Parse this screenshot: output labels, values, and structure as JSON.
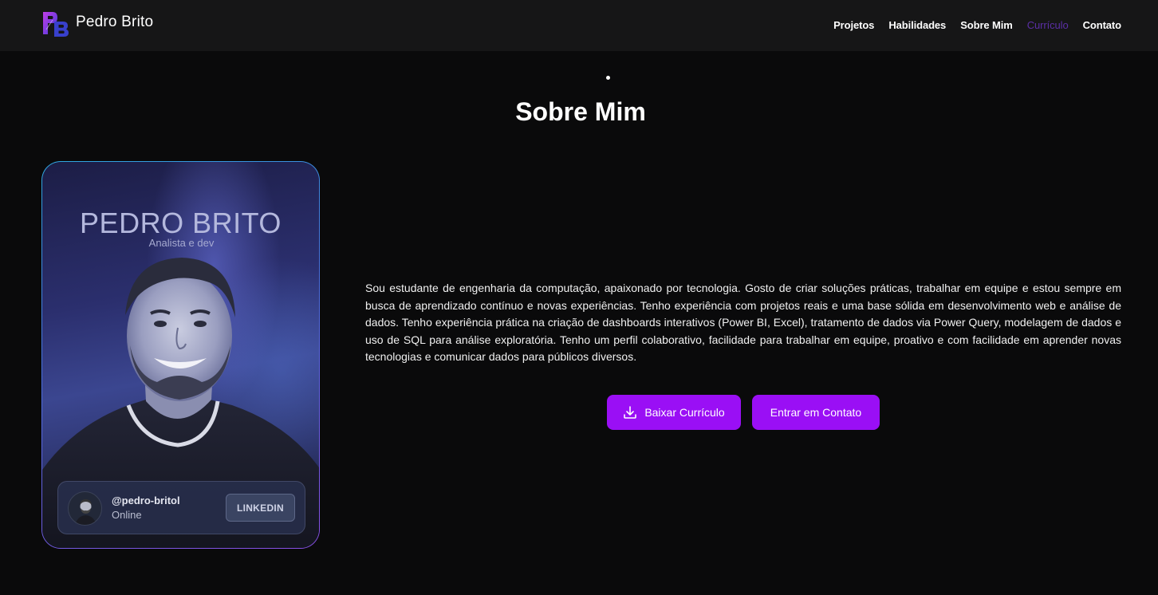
{
  "brand": {
    "logo_letters": "PB",
    "name": "Pedro Brito"
  },
  "nav": {
    "items": [
      {
        "label": "Projetos"
      },
      {
        "label": "Habilidades"
      },
      {
        "label": "Sobre Mim"
      },
      {
        "label": "Currículo",
        "active": true
      },
      {
        "label": "Contato"
      }
    ]
  },
  "about": {
    "title": "Sobre Mim",
    "bio": "Sou estudante de engenharia da computação, apaixonado por tecnologia. Gosto de criar soluções práticas, trabalhar em equipe e estou sempre em busca de aprendizado contínuo e novas experiências. Tenho experiência com projetos reais e uma base sólida em desenvolvimento web e análise de dados. Tenho experiência prática na criação de dashboards interativos (Power BI, Excel), tratamento de dados via Power Query, modelagem de dados e uso de SQL para análise exploratória. Tenho um perfil colaborativo, facilidade para trabalhar em equipe, proativo e com facilidade em aprender novas tecnologias e comunicar dados para públicos diversos."
  },
  "profile_card": {
    "name": "PEDRO BRITO",
    "subtitle": "Analista e dev",
    "handle": "@pedro-britol",
    "status": "Online",
    "button_label": "LINKEDIN"
  },
  "actions": {
    "download_label": "Baixar Currículo",
    "contact_label": "Entrar em Contato"
  },
  "colors": {
    "accent": "#9a0ff5",
    "nav_active": "#5b2fa6",
    "background": "#0a0a0b",
    "navbar": "#161617"
  },
  "icons": [
    "logo-icon",
    "download-icon",
    "avatar-icon"
  ]
}
